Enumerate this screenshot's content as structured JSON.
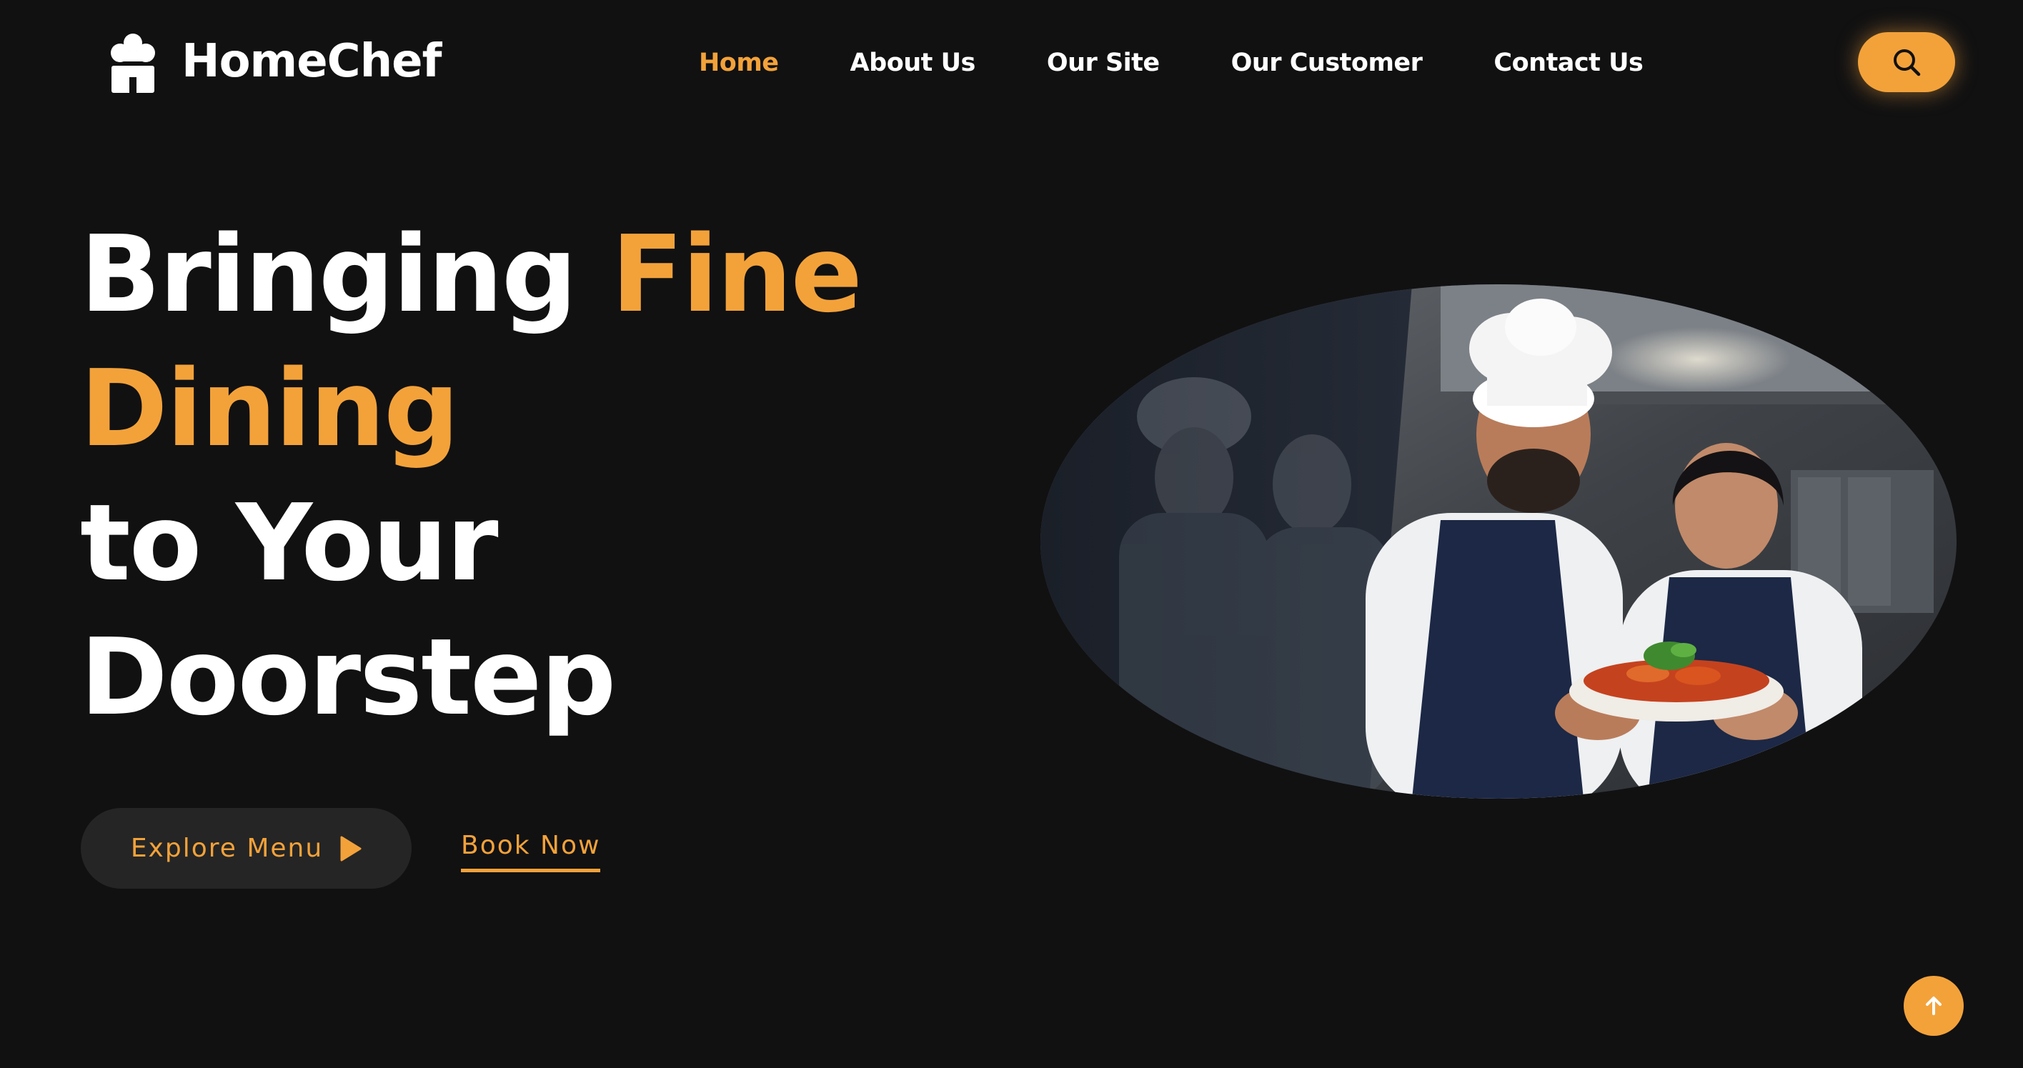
{
  "brand": {
    "name": "HomeChef",
    "icon": "chef-hat-house-icon"
  },
  "nav": {
    "items": [
      {
        "label": "Home",
        "active": true
      },
      {
        "label": "About Us",
        "active": false
      },
      {
        "label": "Our Site",
        "active": false
      },
      {
        "label": "Our Customer",
        "active": false
      },
      {
        "label": "Contact Us",
        "active": false
      }
    ],
    "search_icon": "search-icon"
  },
  "hero": {
    "headline": {
      "part1": "Bringing ",
      "accent1": "Fine",
      "accent2": "Dining",
      "line3": "to Your",
      "line4": "Doorstep"
    },
    "primary_button": {
      "label": "Explore Menu",
      "icon": "play-icon"
    },
    "secondary_link": {
      "label": "Book Now"
    },
    "image": {
      "icon": "chefs-holding-dish-photo"
    }
  },
  "scroll_top": {
    "icon": "arrow-up-icon"
  },
  "colors": {
    "background": "#111112",
    "accent": "#f3a23a",
    "button_dark": "#252525",
    "text": "#ffffff"
  }
}
